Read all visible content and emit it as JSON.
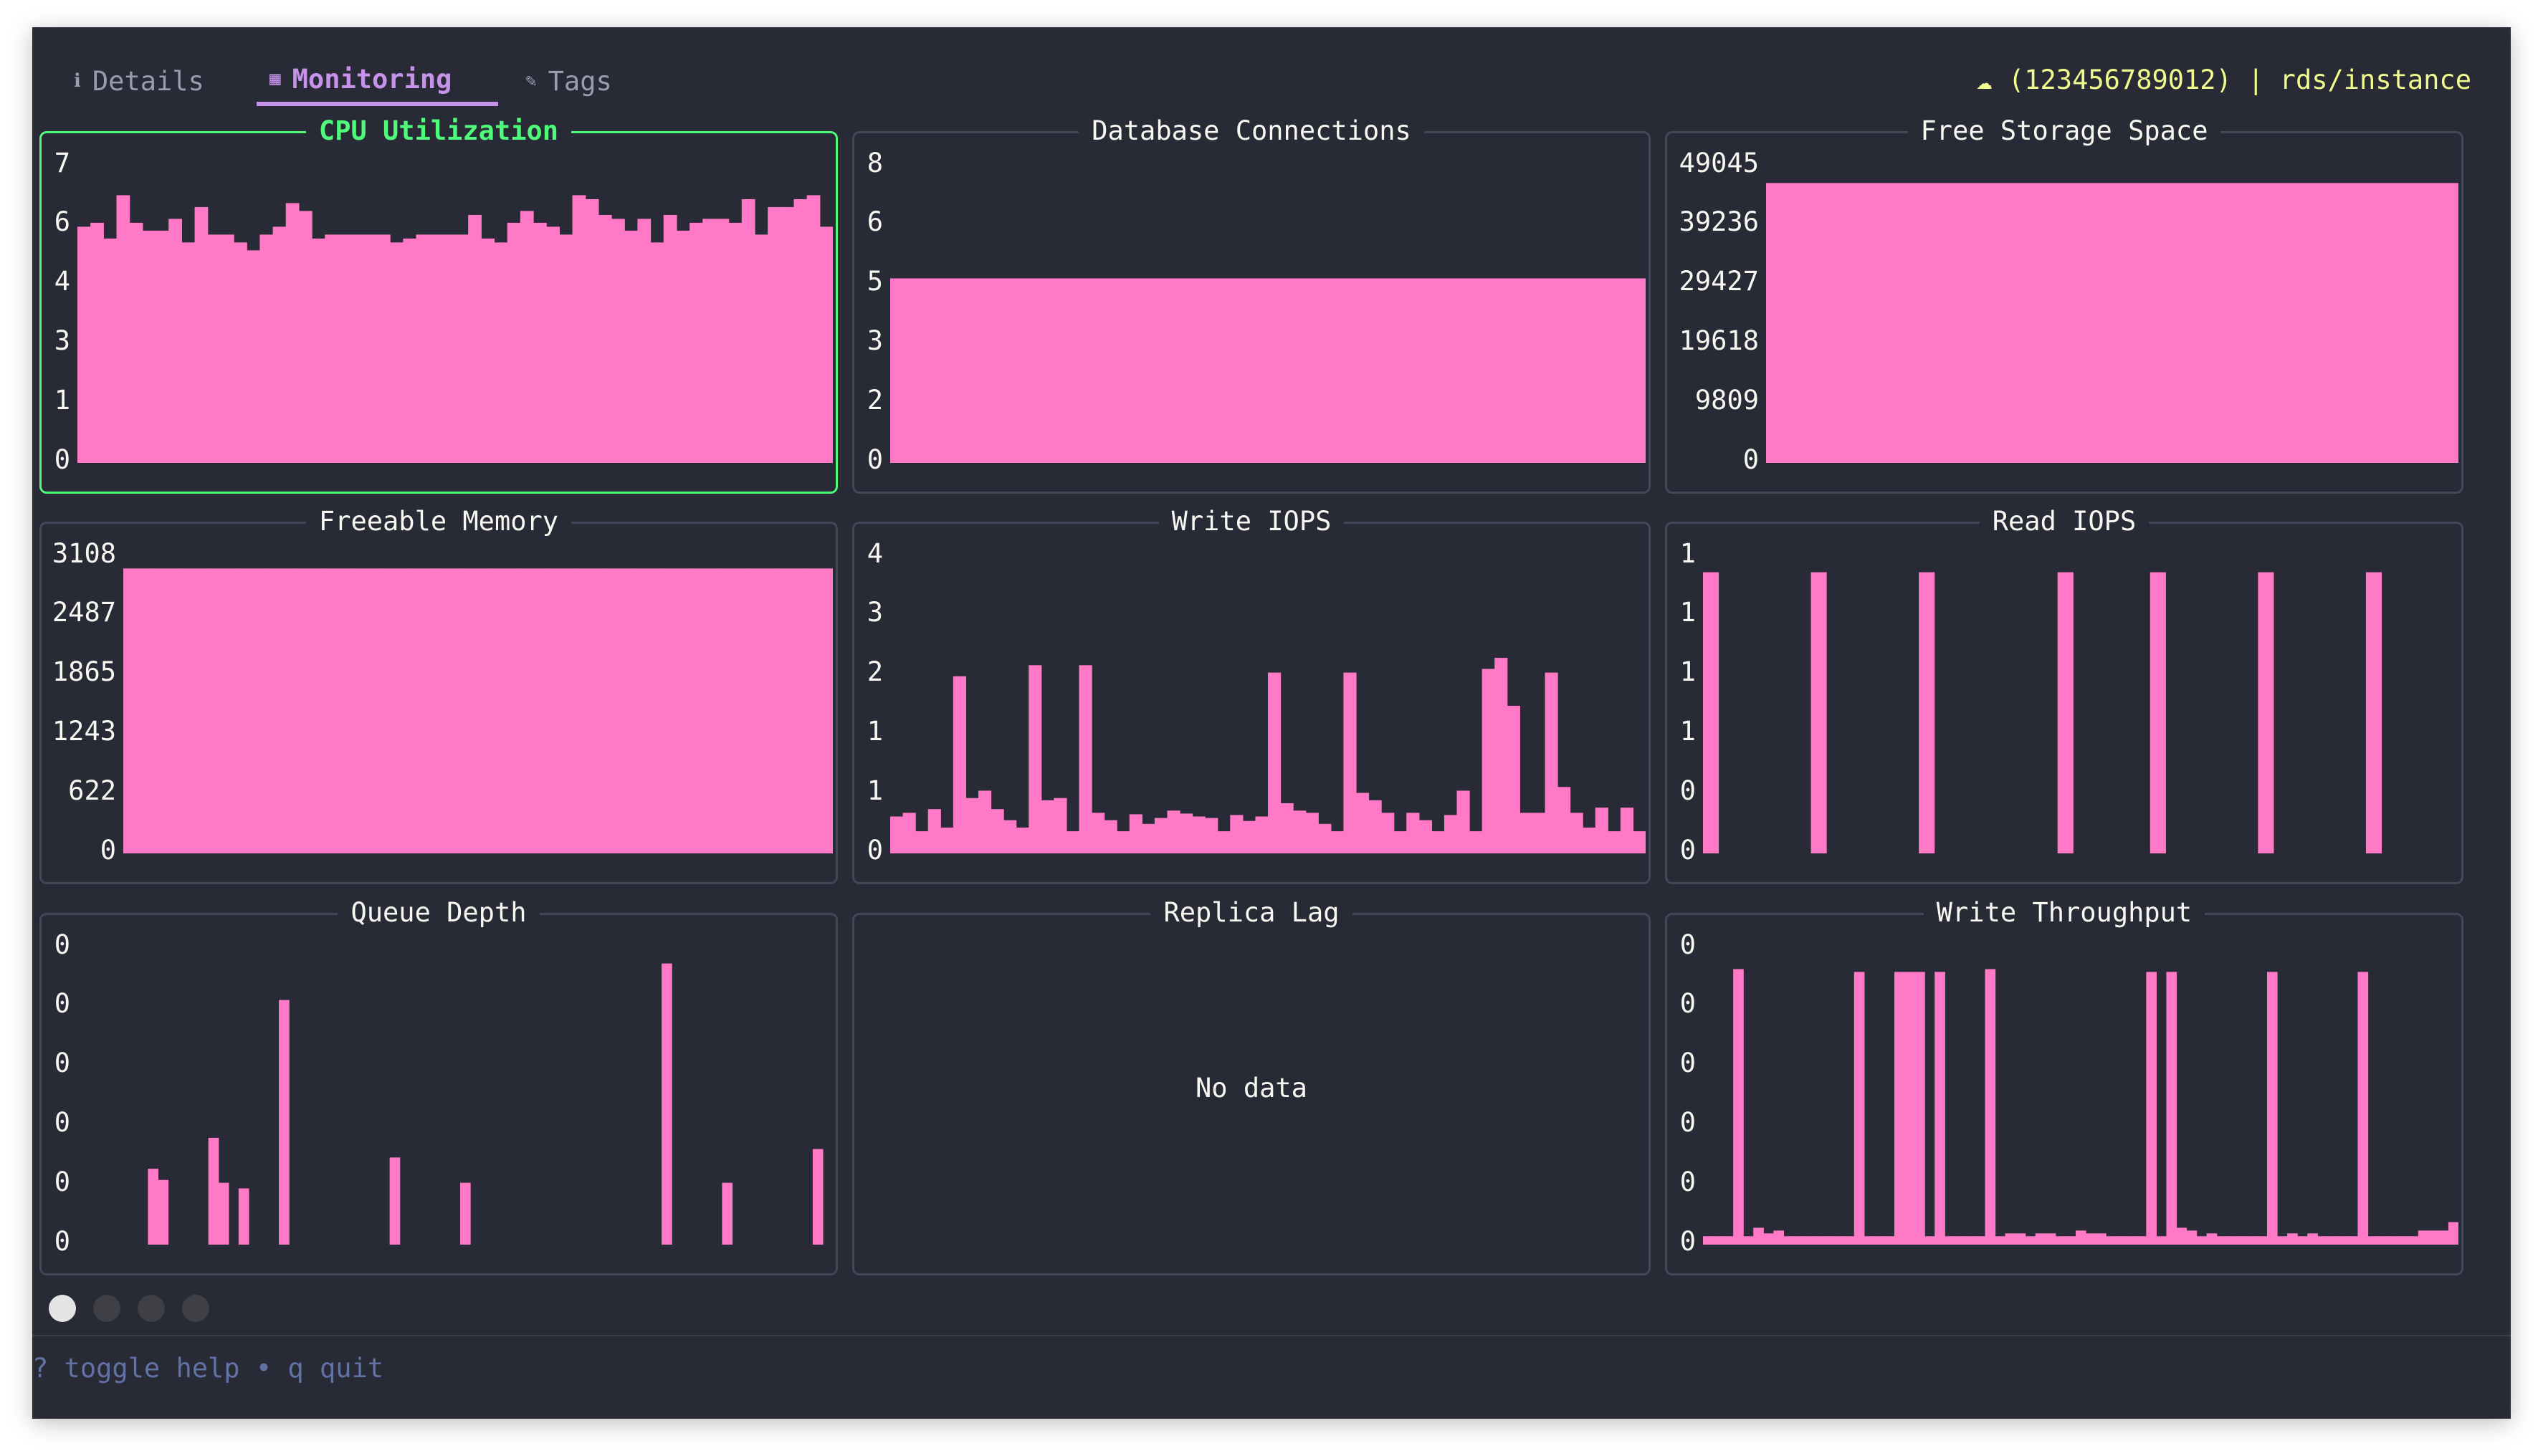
{
  "tabs": [
    {
      "label": "Details",
      "icon": "info-icon",
      "glyph": "ℹ"
    },
    {
      "label": "Monitoring",
      "icon": "chart-icon",
      "glyph": "▦"
    },
    {
      "label": "Tags",
      "icon": "tag-icon",
      "glyph": "✎"
    }
  ],
  "active_tab": "Monitoring",
  "profile": {
    "glyph": "☁",
    "text": "(123456789012) | rds/instance"
  },
  "colors": {
    "bar": "#ff79c6",
    "background": "#282a36",
    "panel_border": "#44475a",
    "focus_border": "#50fa7b",
    "active_tab": "#c792ea",
    "profile_text": "#f1fa8c",
    "help_text": "#6272a4"
  },
  "panels": [
    {
      "title": "CPU Utilization",
      "focused": true,
      "yticks": [
        "7",
        "6",
        "4",
        "3",
        "1",
        "0"
      ]
    },
    {
      "title": "Database Connections",
      "focused": false,
      "yticks": [
        "8",
        "6",
        "5",
        "3",
        "2",
        "0"
      ]
    },
    {
      "title": "Free Storage Space",
      "focused": false,
      "yticks": [
        "49045",
        "39236",
        "29427",
        "19618",
        "9809",
        "0"
      ]
    },
    {
      "title": "Freeable Memory",
      "focused": false,
      "yticks": [
        "3108",
        "2487",
        "1865",
        "1243",
        "622",
        "0"
      ]
    },
    {
      "title": "Write IOPS",
      "focused": false,
      "yticks": [
        "4",
        "3",
        "2",
        "1",
        "1",
        "0"
      ]
    },
    {
      "title": "Read IOPS",
      "focused": false,
      "yticks": [
        "1",
        "1",
        "1",
        "1",
        "0",
        "0"
      ]
    },
    {
      "title": "Queue Depth",
      "focused": false,
      "yticks": [
        "0",
        "0",
        "0",
        "0",
        "0",
        "0"
      ]
    },
    {
      "title": "Replica Lag",
      "focused": false,
      "yticks": [],
      "empty_text": "No data"
    },
    {
      "title": "Write Throughput",
      "focused": false,
      "yticks": [
        "0",
        "0",
        "0",
        "0",
        "0",
        "0"
      ]
    }
  ],
  "chart_data": [
    {
      "type": "bar",
      "title": "CPU Utilization",
      "ylim": [
        0,
        7.5
      ],
      "values": [
        6.0,
        6.1,
        5.7,
        6.8,
        6.1,
        5.9,
        5.9,
        6.2,
        5.6,
        6.5,
        5.8,
        5.8,
        5.6,
        5.4,
        5.8,
        6.0,
        6.6,
        6.4,
        5.7,
        5.8,
        5.8,
        5.8,
        5.8,
        5.8,
        5.6,
        5.7,
        5.8,
        5.8,
        5.8,
        5.8,
        6.3,
        5.7,
        5.6,
        6.1,
        6.4,
        6.1,
        6.0,
        5.8,
        6.8,
        6.7,
        6.3,
        6.2,
        5.9,
        6.2,
        5.6,
        6.3,
        5.9,
        6.1,
        6.2,
        6.2,
        6.1,
        6.7,
        5.8,
        6.5,
        6.5,
        6.7,
        6.8,
        6.0
      ]
    },
    {
      "type": "bar",
      "title": "Database Connections",
      "ylim": [
        0,
        8
      ],
      "values": [
        5,
        5,
        5,
        5,
        5,
        5,
        5,
        5,
        5,
        5,
        5,
        5,
        5,
        5,
        5,
        5,
        5,
        5,
        5,
        5,
        5,
        5,
        5,
        5,
        5
      ]
    },
    {
      "type": "bar",
      "title": "Free Storage Space",
      "ylim": [
        0,
        49045
      ],
      "values": [
        46500,
        46500,
        46500,
        46500,
        46500,
        46500,
        46500,
        46500,
        46500,
        46500,
        46500,
        46500,
        46500,
        46500,
        46500,
        46500,
        46500,
        46500,
        46500,
        46500,
        46500,
        46500,
        46500,
        46500,
        46500
      ]
    },
    {
      "type": "bar",
      "title": "Freeable Memory",
      "ylim": [
        0,
        3108
      ],
      "values": [
        3000,
        3000,
        3000,
        3000,
        3000,
        3000,
        3000,
        3000,
        3000,
        3000,
        3000,
        3000,
        3000,
        3000,
        3000,
        3000,
        3000,
        3000,
        3000,
        3000,
        3000,
        3000,
        3000,
        3000,
        3000
      ]
    },
    {
      "type": "bar",
      "title": "Write IOPS",
      "ylim": [
        0,
        4
      ],
      "values": [
        0.5,
        0.55,
        0.3,
        0.6,
        0.35,
        2.4,
        0.75,
        0.85,
        0.6,
        0.45,
        0.35,
        2.55,
        0.72,
        0.75,
        0.3,
        2.55,
        0.55,
        0.45,
        0.3,
        0.53,
        0.4,
        0.48,
        0.58,
        0.54,
        0.5,
        0.48,
        0.3,
        0.52,
        0.44,
        0.5,
        2.45,
        0.68,
        0.58,
        0.55,
        0.4,
        0.3,
        2.45,
        0.82,
        0.72,
        0.55,
        0.3,
        0.55,
        0.45,
        0.3,
        0.52,
        0.85,
        0.3,
        2.5,
        2.65,
        2.0,
        0.55,
        0.55,
        2.45,
        0.9,
        0.55,
        0.35,
        0.62,
        0.3,
        0.62,
        0.3
      ]
    },
    {
      "type": "bar",
      "title": "Read IOPS",
      "ylim": [
        0,
        1.05
      ],
      "values": [
        1,
        0,
        0,
        0,
        0,
        0,
        0,
        1,
        0,
        0,
        0,
        0,
        0,
        0,
        1,
        0,
        0,
        0,
        0,
        0,
        0,
        0,
        0,
        1,
        0,
        0,
        0,
        0,
        0,
        1,
        0,
        0,
        0,
        0,
        0,
        0,
        1,
        0,
        0,
        0,
        0,
        0,
        0,
        1,
        0,
        0,
        0,
        0,
        0
      ]
    },
    {
      "type": "bar",
      "title": "Queue Depth",
      "ylim": [
        0,
        1.05
      ],
      "values": [
        0,
        0,
        0,
        0,
        0,
        0,
        0,
        0.27,
        0.23,
        0,
        0,
        0,
        0,
        0.38,
        0.22,
        0,
        0.2,
        0,
        0,
        0,
        0.87,
        0,
        0,
        0,
        0,
        0,
        0,
        0,
        0,
        0,
        0,
        0.31,
        0,
        0,
        0,
        0,
        0,
        0,
        0.22,
        0,
        0,
        0,
        0,
        0,
        0,
        0,
        0,
        0,
        0,
        0,
        0,
        0,
        0,
        0,
        0,
        0,
        0,
        0,
        1.0,
        0,
        0,
        0,
        0,
        0,
        0.22,
        0,
        0,
        0,
        0,
        0,
        0,
        0,
        0,
        0.34,
        0
      ]
    },
    {
      "type": "bar",
      "title": "Replica Lag",
      "values": []
    },
    {
      "type": "bar",
      "title": "Write Throughput",
      "ylim": [
        0,
        1.05
      ],
      "values": [
        0.03,
        0.03,
        0.03,
        0.98,
        0.03,
        0.06,
        0.04,
        0.05,
        0.03,
        0.03,
        0.03,
        0.03,
        0.03,
        0.03,
        0.03,
        0.97,
        0.03,
        0.03,
        0.03,
        0.97,
        0.97,
        0.97,
        0.03,
        0.97,
        0.03,
        0.03,
        0.03,
        0.03,
        0.98,
        0.03,
        0.04,
        0.04,
        0.03,
        0.04,
        0.04,
        0.03,
        0.03,
        0.05,
        0.04,
        0.04,
        0.03,
        0.03,
        0.03,
        0.03,
        0.97,
        0.03,
        0.97,
        0.06,
        0.05,
        0.03,
        0.04,
        0.03,
        0.03,
        0.03,
        0.03,
        0.03,
        0.97,
        0.03,
        0.04,
        0.03,
        0.04,
        0.03,
        0.03,
        0.03,
        0.03,
        0.97,
        0.03,
        0.03,
        0.03,
        0.03,
        0.03,
        0.05,
        0.05,
        0.05,
        0.08
      ]
    }
  ],
  "pagination": {
    "pages": 4,
    "current": 1
  },
  "help_text": "? toggle help • q quit"
}
